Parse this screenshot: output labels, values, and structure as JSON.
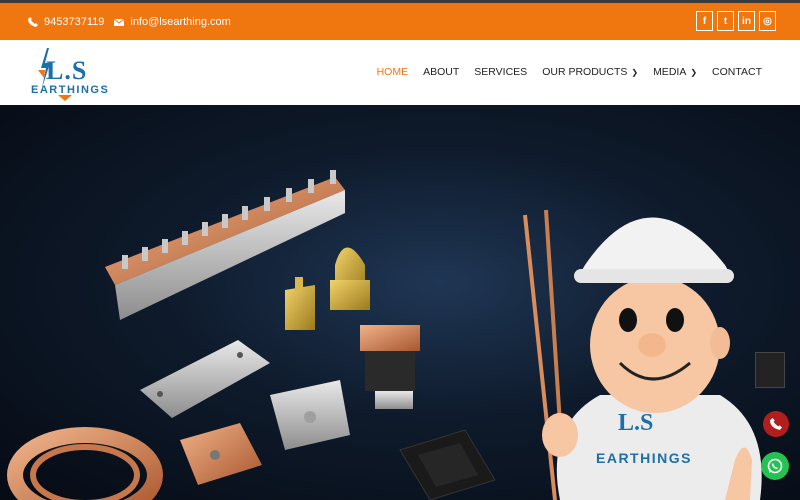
{
  "topbar": {
    "phone": "9453737119",
    "email": "info@lsearthing.com",
    "social": [
      {
        "icon": "facebook-icon",
        "glyph": "f"
      },
      {
        "icon": "twitter-icon",
        "glyph": "t"
      },
      {
        "icon": "linkedin-icon",
        "glyph": "in"
      },
      {
        "icon": "instagram-icon",
        "glyph": "◎"
      }
    ]
  },
  "logo": {
    "mark": "L.S",
    "subtitle": "EARTHINGS"
  },
  "nav": {
    "home": "HOME",
    "about": "ABOUT",
    "services": "SERVICES",
    "products": "OUR PRODUCTS",
    "media": "MEDIA",
    "contact": "CONTACT"
  },
  "mascot": {
    "shirt_mark": "L.S",
    "shirt_text": "EARTHINGS"
  },
  "colors": {
    "accent": "#f0760f",
    "brand_blue": "#1d6fa8",
    "hero_dark": "#0e1a2b"
  }
}
